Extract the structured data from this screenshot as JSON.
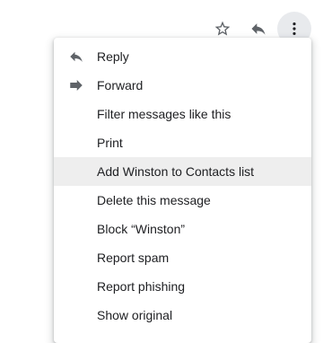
{
  "toolbar": {
    "icons": [
      "star-icon",
      "reply-icon",
      "more-vert-icon"
    ]
  },
  "menu": {
    "items": [
      {
        "label": "Reply",
        "icon": "reply-icon"
      },
      {
        "label": "Forward",
        "icon": "forward-icon"
      },
      {
        "label": "Filter messages like this"
      },
      {
        "label": "Print"
      },
      {
        "label": "Add Winston to Contacts list",
        "state": "hovered"
      },
      {
        "label": "Delete this message"
      },
      {
        "label": "Block “Winston”"
      },
      {
        "label": "Report spam"
      },
      {
        "label": "Report phishing"
      },
      {
        "label": "Show original"
      }
    ]
  },
  "colors": {
    "icon": "#5f6368",
    "text": "#202124",
    "hover_background": "#eeeeee",
    "active_button_background": "#e8eaed"
  }
}
